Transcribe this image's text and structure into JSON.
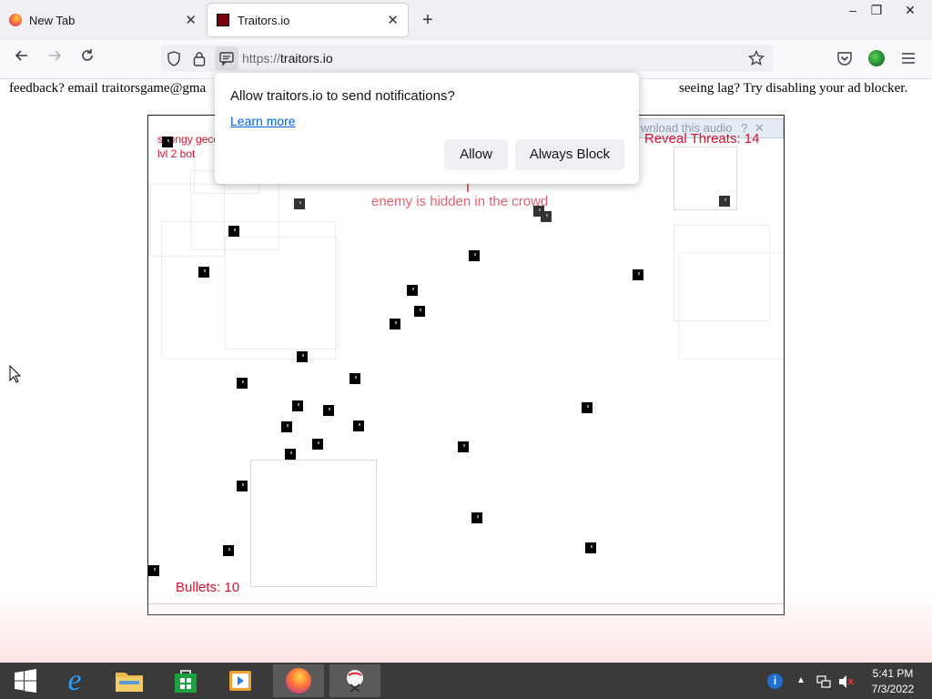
{
  "browser": {
    "tabs": [
      {
        "title": "New Tab",
        "active": false
      },
      {
        "title": "Traitors.io",
        "active": true
      }
    ],
    "new_tab_glyph": "+",
    "url_scheme": "https://",
    "url_host": "traitors.io",
    "window_controls": {
      "minimize": "–",
      "restore": "❐",
      "close": "✕"
    }
  },
  "page": {
    "top_left_text": "feedback? email traitorsgame@gma",
    "top_right_text": "seeing lag? Try disabling your ad blocker."
  },
  "game": {
    "player_name_1": "spongy geco",
    "player_name_2": "lvl 2 bot",
    "hint": "enemy is hidden in the crowd",
    "reveal_threats": "Reveal Threats: 14",
    "bullets": "Bullets: 10",
    "audio_banner": "wnload this audio",
    "audio_help": "?",
    "audio_close": "✕"
  },
  "notification": {
    "question": "Allow traitors.io to send notifications?",
    "learn_more": "Learn more",
    "allow_label": "Allow",
    "block_label": "Always Block"
  },
  "taskbar": {
    "time": "5:41 PM",
    "date": "7/3/2022",
    "apps": [
      "start",
      "internet-explorer",
      "file-explorer",
      "store",
      "media-player",
      "firefox",
      "snipping-tool"
    ]
  },
  "colors": {
    "accent_red": "#d6112e",
    "link_blue": "#0060df",
    "taskbar": "#3a3a3a"
  }
}
